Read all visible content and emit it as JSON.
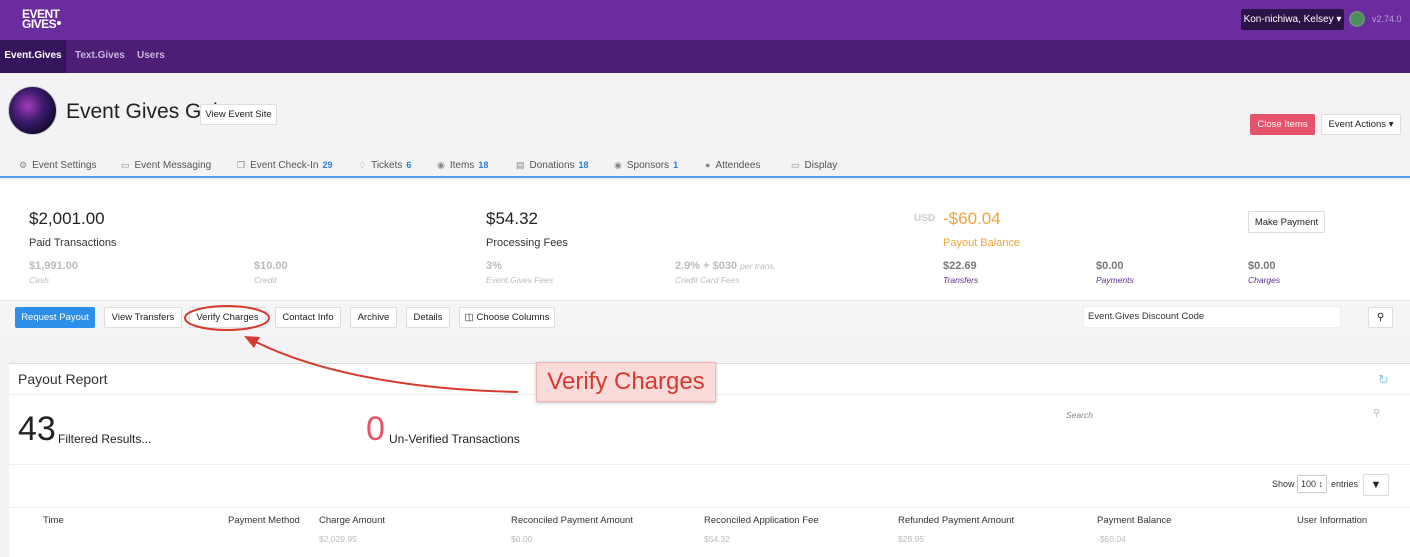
{
  "app": {
    "logo_line1": "EVENT",
    "logo_line2": "GIVES",
    "version": "v2.74.0",
    "user_menu": "Kon-nichiwa, Kelsey ▾"
  },
  "nav": {
    "tabs": [
      "Event.Gives",
      "Text.Gives",
      "Users"
    ]
  },
  "event": {
    "title": "Event Gives Gala",
    "view_site": "View Event Site",
    "close_items": "Close Items",
    "event_actions": "Event Actions ▾"
  },
  "event_tabs": [
    {
      "label": "Event Settings",
      "icon": "gear-icon",
      "count": ""
    },
    {
      "label": "Event Messaging",
      "icon": "inbox-icon",
      "count": ""
    },
    {
      "label": "Event Check-In",
      "icon": "copy-icon",
      "count": "29"
    },
    {
      "label": "Tickets",
      "icon": "tag-icon",
      "count": "6"
    },
    {
      "label": "Items",
      "icon": "items-icon",
      "count": "18"
    },
    {
      "label": "Donations",
      "icon": "donation-icon",
      "count": "18"
    },
    {
      "label": "Sponsors",
      "icon": "eye-icon",
      "count": "1"
    },
    {
      "label": "Attendees",
      "icon": "users-icon",
      "count": ""
    },
    {
      "label": "Display",
      "icon": "monitor-icon",
      "count": ""
    }
  ],
  "stats": {
    "paid_amount": "$2,001.00",
    "paid_label": "Paid Transactions",
    "cash_amount": "$1,991.00",
    "cash_label": "Cash",
    "credit_amount": "$10.00",
    "credit_label": "Credit",
    "fees_amount": "$54.32",
    "fees_label": "Processing Fees",
    "eg_fee_pct": "3%",
    "eg_fee_label": "Event.Gives Fees",
    "cc_fee": "2.9% + $030",
    "cc_fee_suffix": "per trans.",
    "cc_fee_label": "Credit Card Fees",
    "currency": "USD",
    "payout_amount": "-$60.04",
    "payout_label": "Payout Balance",
    "transfers_amount": "$22.69",
    "transfers_label": "Transfers",
    "payments_amount": "$0.00",
    "payments_label": "Payments",
    "charges_amount": "$0.00",
    "charges_label": "Charges",
    "make_payment": "Make Payment"
  },
  "actions": {
    "request_payout": "Request Payout",
    "view_transfers": "View Transfers",
    "verify_charges": "Verify Charges",
    "contact_info": "Contact Info",
    "archive": "Archive",
    "details": "Details",
    "choose_columns": "Choose Columns",
    "discount_code": "Event.Gives Discount Code"
  },
  "report": {
    "title": "Payout Report",
    "filtered_count": "43",
    "filtered_label": "Filtered Results...",
    "unverified_count": "0",
    "unverified_label": "Un-Verified Transactions",
    "search_placeholder": "Search",
    "show_label": "Show",
    "entries_value": "100 ↕",
    "entries_label": "entries",
    "columns": [
      "Time",
      "Payment Method",
      "Charge Amount",
      "Reconciled Payment Amount",
      "Reconciled Application Fee",
      "Refunded Payment Amount",
      "Payment Balance",
      "User Information"
    ],
    "totals": [
      "$2,029.95",
      "$0.00",
      "$54.32",
      "$28.95",
      "-$60.04"
    ]
  },
  "annotation": {
    "text": "Verify Charges",
    "color": "#d63b2f"
  },
  "colors": {
    "brand_purple": "#6a2c9f",
    "accent_blue": "#2d8fe8",
    "alert_red": "#e5536a",
    "payout_orange": "#f0a13a"
  }
}
